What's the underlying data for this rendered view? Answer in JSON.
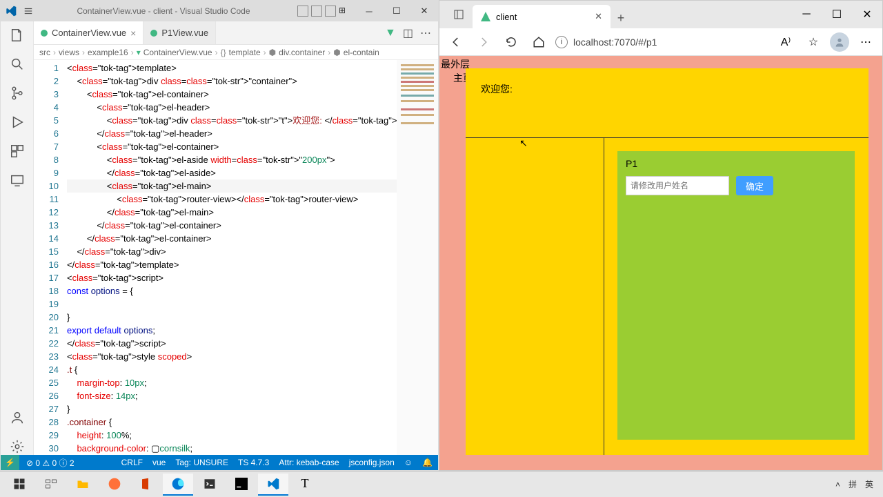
{
  "vscode": {
    "title": "ContainerView.vue - client - Visual Studio Code",
    "tabs": [
      {
        "label": "ContainerView.vue",
        "active": true
      },
      {
        "label": "P1View.vue",
        "active": false
      }
    ],
    "breadcrumb": [
      "src",
      "views",
      "example16",
      "ContainerView.vue",
      "template",
      "div.container",
      "el-contain"
    ],
    "code_lines": [
      "<template>",
      "    <div class=\"container\">",
      "        <el-container>",
      "            <el-header>",
      "                <div class=\"t\">欢迎您: </div>",
      "            </el-header>",
      "            <el-container>",
      "                <el-aside width=\"200px\">",
      "                </el-aside>",
      "                <el-main>",
      "                    <router-view></router-view>",
      "                </el-main>",
      "            </el-container>",
      "        </el-container>",
      "    </div>",
      "</template>",
      "<script>",
      "const options = {",
      "",
      "}",
      "export default options;",
      "</script>",
      "<style scoped>",
      ".t {",
      "    margin-top: 10px;",
      "    font-size: 14px;",
      "}",
      ".container {",
      "    height: 100%;",
      "    background-color: ▢cornsilk;"
    ],
    "highlight_line": 10,
    "status": {
      "errors": "0",
      "warnings": "0",
      "info": "2",
      "crlf": "CRLF",
      "lang": "vue",
      "tag": "Tag: UNSURE",
      "ts": "TS 4.7.3",
      "attr": "Attr: kebab-case",
      "jsconfig": "jsconfig.json"
    }
  },
  "browser": {
    "tab_title": "client",
    "url": "localhost:7070/#/p1",
    "page": {
      "outer_label": "最外层",
      "main_label": "主页",
      "welcome": "欢迎您:",
      "p1_title": "P1",
      "input_placeholder": "请修改用户姓名",
      "button_label": "确定"
    }
  },
  "taskbar": {
    "tray": {
      "ime1": "拼",
      "ime2": "英"
    }
  }
}
